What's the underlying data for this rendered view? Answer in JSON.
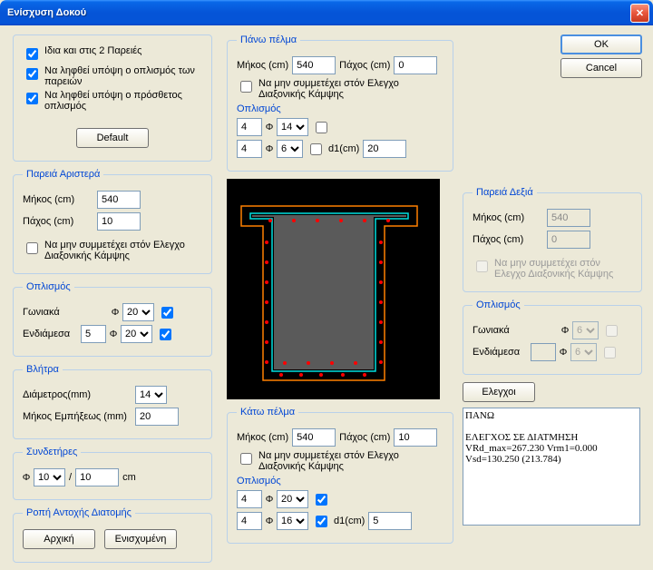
{
  "window": {
    "title": "Ενίσχυση Δοκού"
  },
  "buttons": {
    "ok": "OK",
    "cancel": "Cancel",
    "default": "Default",
    "elegxoi": "Ελεγχοι",
    "arxiki": "Αρχική",
    "enisxymeni": "Ενισχυμένη"
  },
  "checks": {
    "same2": "Ιδια και στις 2 Παρειές",
    "lamb_oplismos_pareion": "Να ληφθεί υπόψη ο οπλισμός των παρειών",
    "lamb_prosthetos": "Να ληφθεί υπόψη ο πρόσθετος οπλισμός",
    "na_min_diax": "Να μην συμμετέχει στόν Ελεγχο Διαξονικής Κάμψης"
  },
  "labels": {
    "mikos_cm": "Μήκος (cm)",
    "paxos_cm": "Πάχος (cm)",
    "oplismos": "Οπλισμός",
    "goniaka": "Γωνιακά",
    "endiamesa": "Ενδιάμεσα",
    "phi": "Φ",
    "d1cm": "d1(cm)",
    "diametros_mm": "Διάμετρος(mm)",
    "mikos_empix": "Μήκος Εμπήξεως (mm)",
    "cm": "cm"
  },
  "groups": {
    "pano_pelma": "Πάνω πέλμα",
    "kato_pelma": "Κάτω πέλμα",
    "pareia_aristera": "Παρειά Αριστερά",
    "pareia_dexia": "Παρειά Δεξιά",
    "vlitra": "Βλήτρα",
    "syndetires": "Συνδετήρες",
    "ropi": "Ροπή Αντοχής Διατομής"
  },
  "values": {
    "pano": {
      "mikos": "540",
      "paxos": "0",
      "row1_n": "4",
      "row1_phi": "14",
      "row2_n": "4",
      "row2_phi": "6",
      "d1": "20"
    },
    "kato": {
      "mikos": "540",
      "paxos": "10",
      "row1_n": "4",
      "row1_phi": "20",
      "row2_n": "4",
      "row2_phi": "16",
      "d1": "5"
    },
    "aristera": {
      "mikos": "540",
      "paxos": "10",
      "gon_phi": "20",
      "end_n": "5",
      "end_phi": "20"
    },
    "dexia": {
      "mikos": "540",
      "paxos": "0",
      "gon_phi": "6",
      "end_n": "",
      "end_phi": "6"
    },
    "vlitra": {
      "diam": "14",
      "emp": "20"
    },
    "synd": {
      "phi": "10",
      "dist": "10"
    }
  },
  "results": "ΠΑΝΩ\n\nΕΛΕΓΧΟΣ ΣΕ ΔΙΑΤΜΗΣΗ\nVRd_max=267.230 Vrm1=0.000\nVsd=130.250 (213.784)"
}
